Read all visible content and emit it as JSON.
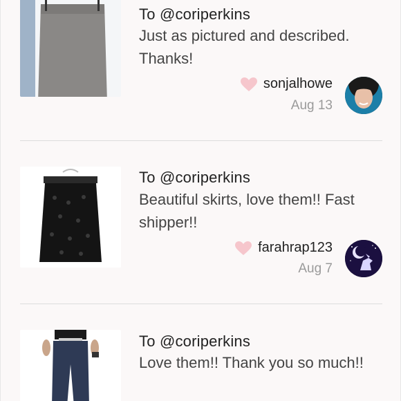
{
  "reviews": [
    {
      "to": "To @coriperkins",
      "comment": "Just as pictured and described. Thanks!",
      "author": "sonjalhowe",
      "date": "Aug 13",
      "thumb_icon": "gray-pencil-skirt-photo",
      "avatar_icon": "sonjalhowe-avatar"
    },
    {
      "to": "To @coriperkins",
      "comment": "Beautiful skirts, love them!! Fast shipper!!",
      "author": "farahrap123",
      "date": "Aug 7",
      "thumb_icon": "black-lace-skirt-photo",
      "avatar_icon": "farahrap123-avatar"
    },
    {
      "to": "To @coriperkins",
      "comment": "Love them!! Thank you so much!!",
      "thumb_icon": "dark-jeans-photo"
    }
  ],
  "colors": {
    "heart": "#f6c6cc",
    "background": "#fbf8f8",
    "divider": "#dcdcdc"
  }
}
